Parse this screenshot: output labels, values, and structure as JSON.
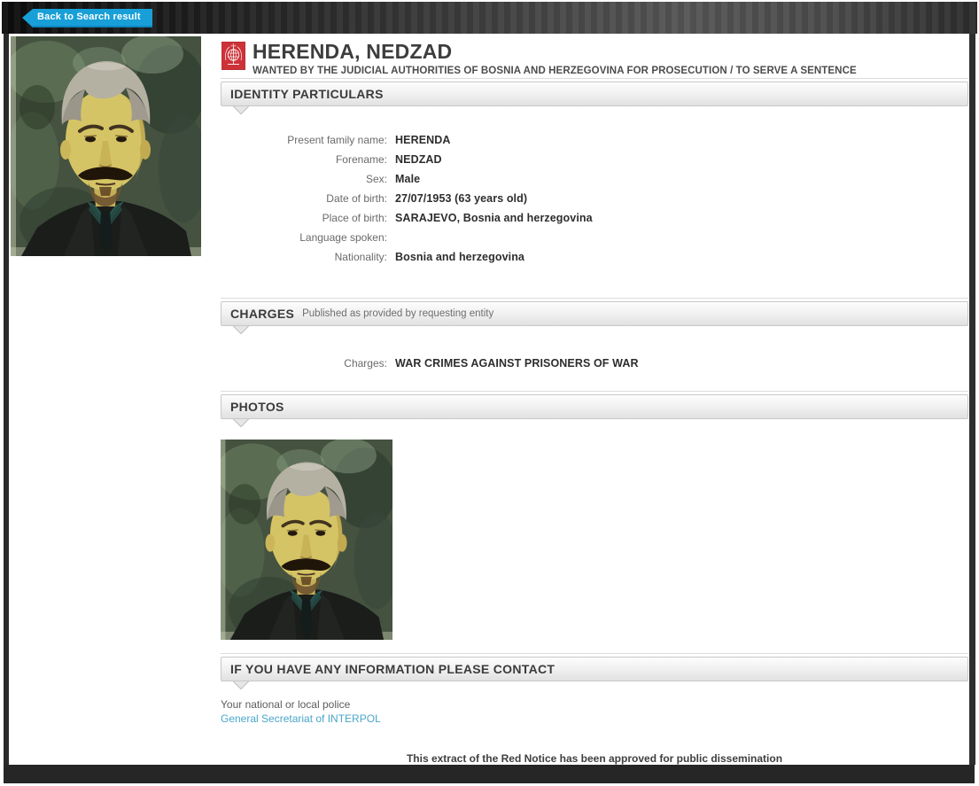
{
  "back_button": {
    "label": "Back to Search result"
  },
  "subject": {
    "title": "HERENDA, NEDZAD",
    "subtitle": "WANTED BY THE JUDICIAL AUTHORITIES OF BOSNIA AND HERZEGOVINA FOR PROSECUTION / TO SERVE A SENTENCE"
  },
  "sections": {
    "identity": {
      "title": "IDENTITY PARTICULARS",
      "fields": [
        {
          "label": "Present family name:",
          "value": "HERENDA"
        },
        {
          "label": "Forename:",
          "value": "NEDZAD"
        },
        {
          "label": "Sex:",
          "value": "Male"
        },
        {
          "label": "Date of birth:",
          "value": "27/07/1953 (63 years old)"
        },
        {
          "label": "Place of birth:",
          "value": "SARAJEVO, Bosnia and herzegovina"
        },
        {
          "label": "Language spoken:",
          "value": ""
        },
        {
          "label": "Nationality:",
          "value": "Bosnia and herzegovina"
        }
      ]
    },
    "charges": {
      "title": "CHARGES",
      "note": "Published as provided by requesting entity",
      "fields": [
        {
          "label": "Charges:",
          "value": "WAR CRIMES AGAINST PRISONERS OF WAR"
        }
      ]
    },
    "photos": {
      "title": "PHOTOS"
    },
    "contact": {
      "title": "IF YOU HAVE ANY INFORMATION PLEASE CONTACT",
      "line1": "Your national or local police",
      "link_label": "General Secretariat of INTERPOL"
    }
  },
  "footer": {
    "note": "This extract of the Red Notice has been approved for public dissemination"
  },
  "icons": {
    "emblem": "interpol-emblem-icon",
    "back_arrow": "back-arrow-icon",
    "section_notch": "pointer-notch"
  },
  "colors": {
    "accent_blue": "#189fd7",
    "link_blue": "#4aa6c9",
    "interpol_red": "#cd3238",
    "chrome_dark": "#2a2a2a"
  }
}
